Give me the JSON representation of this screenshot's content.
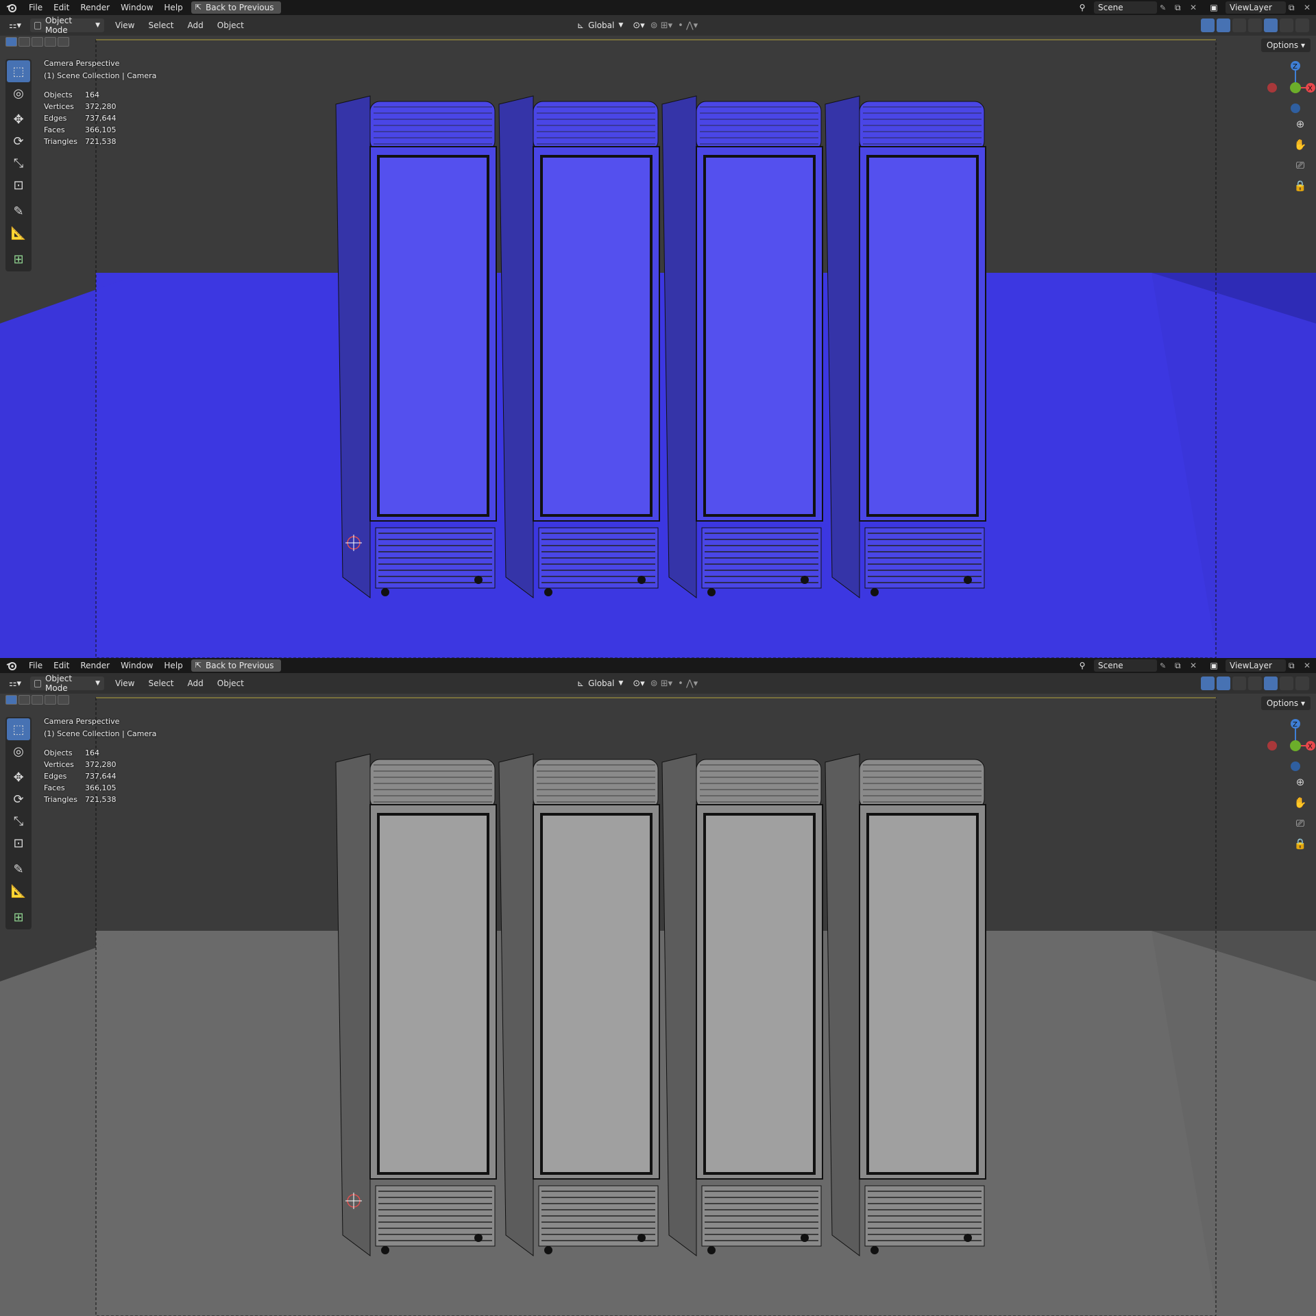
{
  "menubar": {
    "items": [
      "File",
      "Edit",
      "Render",
      "Window",
      "Help"
    ],
    "back_button": "Back to Previous",
    "scene": "Scene",
    "view_layer": "ViewLayer"
  },
  "header": {
    "mode": "Object Mode",
    "menus": [
      "View",
      "Select",
      "Add",
      "Object"
    ],
    "orientation": "Global",
    "options_label": "Options"
  },
  "viewport_info": {
    "view_name": "Camera Perspective",
    "collection": "(1) Scene Collection | Camera",
    "stats": [
      {
        "label": "Objects",
        "value": "164"
      },
      {
        "label": "Vertices",
        "value": "372,280"
      },
      {
        "label": "Edges",
        "value": "737,644"
      },
      {
        "label": "Faces",
        "value": "366,105"
      },
      {
        "label": "Triangles",
        "value": "721,538"
      }
    ]
  },
  "gizmo": {
    "z_label": "Z",
    "x_label": "X"
  },
  "panes": [
    {
      "name": "top",
      "shading": "solid-random-color",
      "background": "#3b3b3b",
      "object_color": "#4a46e6"
    },
    {
      "name": "bottom",
      "shading": "solid-gray",
      "background": "#3b3b3b",
      "object_color": "#8a8a8a"
    }
  ],
  "colors": {
    "accent": "#4772b3",
    "axis_x": "#e8474b",
    "axis_y": "#6cae2a",
    "axis_z": "#3f7fd6"
  }
}
